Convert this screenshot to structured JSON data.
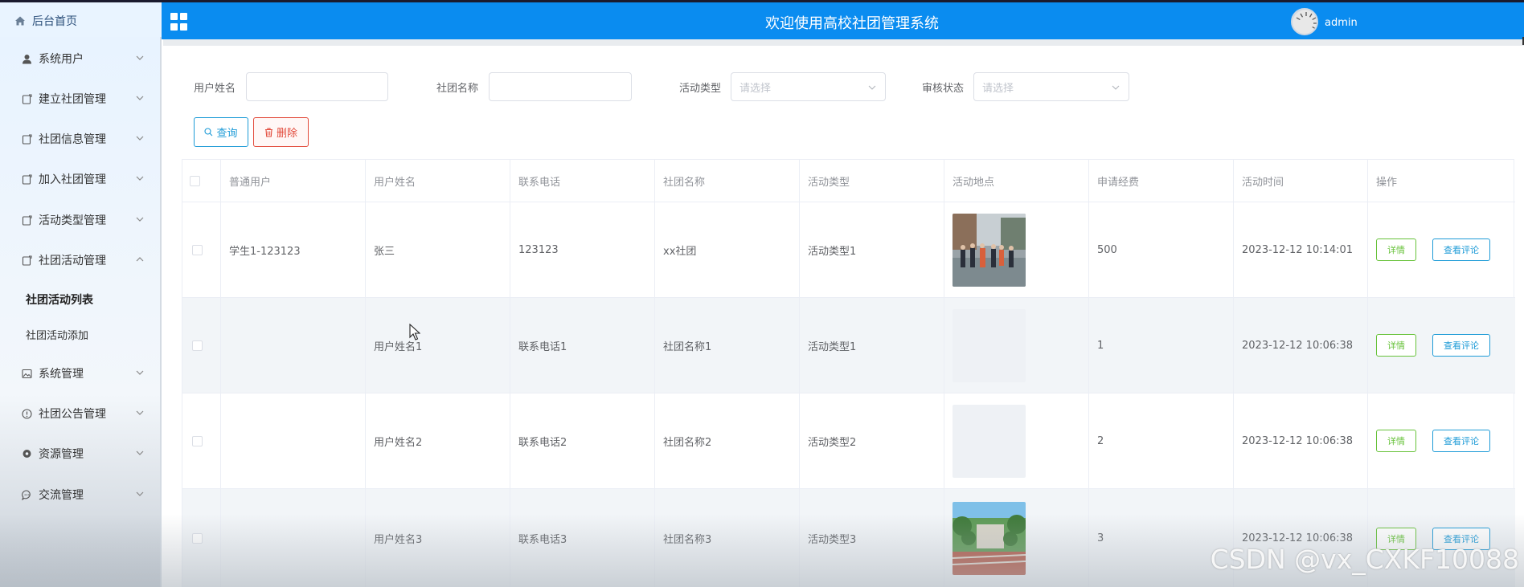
{
  "header": {
    "home_label": "后台首页",
    "title": "欢迎使用高校社团管理系统",
    "username": "admin"
  },
  "sidebar": {
    "items": [
      {
        "label": "系统用户",
        "icon": "user-icon"
      },
      {
        "label": "建立社团管理",
        "icon": "doc-icon"
      },
      {
        "label": "社团信息管理",
        "icon": "doc-icon"
      },
      {
        "label": "加入社团管理",
        "icon": "doc-icon"
      },
      {
        "label": "活动类型管理",
        "icon": "doc-icon"
      },
      {
        "label": "社团活动管理",
        "icon": "doc-icon",
        "expanded": true
      },
      {
        "label": "系统管理",
        "icon": "picture-icon"
      },
      {
        "label": "社团公告管理",
        "icon": "info-icon"
      },
      {
        "label": "资源管理",
        "icon": "location-icon"
      },
      {
        "label": "交流管理",
        "icon": "chat-icon"
      }
    ],
    "sub_items": [
      {
        "label": "社团活动列表",
        "active": true
      },
      {
        "label": "社团活动添加",
        "active": false
      }
    ]
  },
  "filters": {
    "username_label": "用户姓名",
    "username_value": "",
    "club_label": "社团名称",
    "club_value": "",
    "type_label": "活动类型",
    "type_placeholder": "请选择",
    "status_label": "审核状态",
    "status_placeholder": "请选择"
  },
  "buttons": {
    "search": "查询",
    "delete": "删除"
  },
  "table": {
    "columns": [
      "普通用户",
      "用户姓名",
      "联系电话",
      "社团名称",
      "活动类型",
      "活动地点",
      "申请经费",
      "活动时间",
      "操作"
    ],
    "rows": [
      {
        "user": "学生1-123123",
        "name": "张三",
        "phone": "123123",
        "club": "xx社团",
        "type": "活动类型1",
        "photo": "people-photo",
        "funds": "500",
        "time": "2023-12-12 10:14:01"
      },
      {
        "user": "",
        "name": "用户姓名1",
        "phone": "联系电话1",
        "club": "社团名称1",
        "type": "活动类型1",
        "photo": "empty",
        "funds": "1",
        "time": "2023-12-12 10:06:38"
      },
      {
        "user": "",
        "name": "用户姓名2",
        "phone": "联系电话2",
        "club": "社团名称2",
        "type": "活动类型2",
        "photo": "empty",
        "funds": "2",
        "time": "2023-12-12 10:06:38"
      },
      {
        "user": "",
        "name": "用户姓名3",
        "phone": "联系电话3",
        "club": "社团名称3",
        "type": "活动类型3",
        "photo": "campus-photo",
        "funds": "3",
        "time": "2023-12-12 10:06:38"
      }
    ],
    "detail_label": "详情",
    "comment_label": "查看评论"
  },
  "watermark": "CSDN @vx_CXKF10088"
}
